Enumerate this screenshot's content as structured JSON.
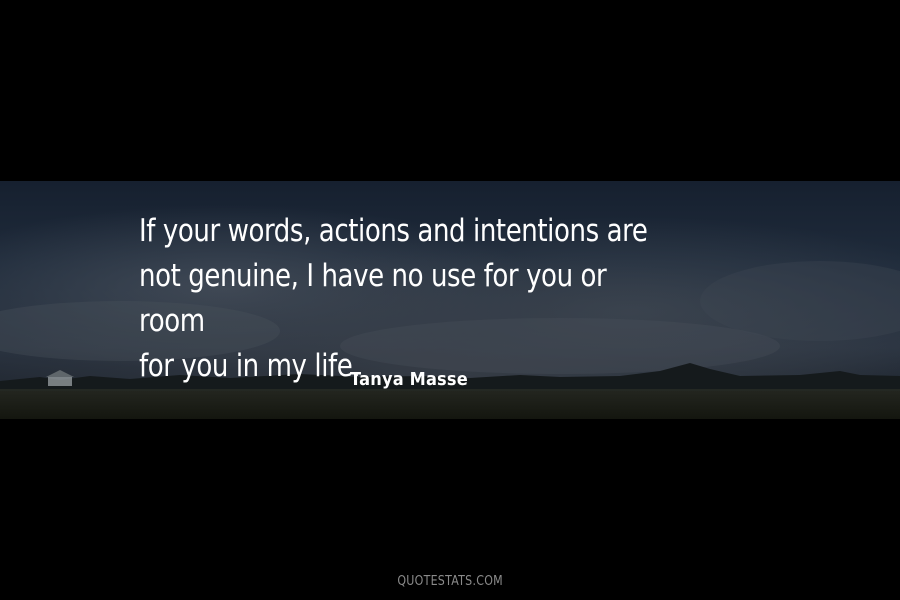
{
  "quote": {
    "lines": [
      "If your words, actions and intentions are",
      "not genuine, I have no use for you or room",
      "for you in my life."
    ]
  },
  "author": "Tanya Masse",
  "footer": "QUOTESTATS.COM",
  "colors": {
    "background": "#000000",
    "text": "#ffffff",
    "footer": "#8a8a8a"
  }
}
